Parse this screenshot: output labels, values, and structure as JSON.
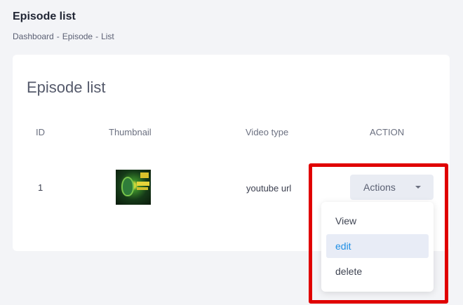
{
  "page": {
    "title": "Episode list",
    "breadcrumb": [
      "Dashboard",
      "Episode",
      "List"
    ],
    "breadcrumb_separator": "-"
  },
  "card": {
    "title": "Episode list",
    "columns": {
      "id": "ID",
      "thumbnail": "Thumbnail",
      "video_type": "Video type",
      "action": "ACTION"
    },
    "rows": [
      {
        "id": "1",
        "video_type": "youtube url",
        "thumbnail_icon": "episode-thumbnail-image"
      }
    ]
  },
  "actions": {
    "button_label": "Actions",
    "menu": [
      "View",
      "edit",
      "delete"
    ],
    "active_item": "edit"
  },
  "colors": {
    "highlight_border": "#e00000",
    "active_item_text": "#1f8fe5",
    "active_item_bg": "#e8ecf6"
  }
}
